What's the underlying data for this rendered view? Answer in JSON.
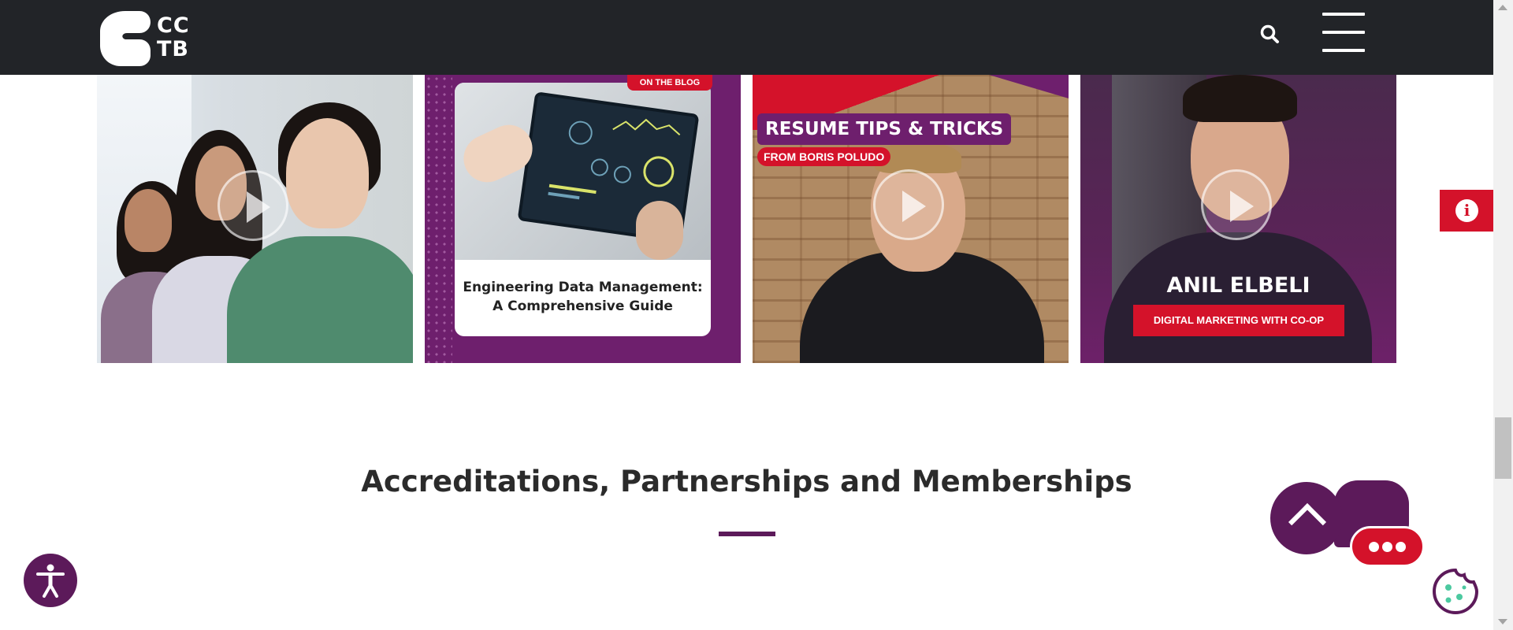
{
  "header": {
    "logo_text_line1": "CC",
    "logo_text_line2": "TB",
    "search_icon": "search-icon",
    "menu_icon": "hamburger-menu-icon"
  },
  "cards": [
    {
      "type": "video",
      "label": "students-video"
    },
    {
      "type": "blog",
      "badge": "ON THE BLOG",
      "title_line1": "Engineering Data Management:",
      "title_line2": "A Comprehensive Guide"
    },
    {
      "type": "video",
      "title": "RESUME TIPS & TRICKS",
      "subtitle": "FROM BORIS POLUDO"
    },
    {
      "type": "video",
      "name": "ANIL ELBELI",
      "tag": "DIGITAL MARKETING WITH CO-OP"
    }
  ],
  "section": {
    "title": "Accreditations, Partnerships and Memberships"
  },
  "floating": {
    "info_icon_glyph": "i",
    "accessibility_icon": "accessibility-icon",
    "back_to_top_icon": "chevron-up-icon",
    "chat_icon": "chat-icon",
    "cookie_icon": "cookie-icon"
  },
  "colors": {
    "header_bg": "#222428",
    "brand_purple": "#5c1a5a",
    "brand_red": "#d4122a"
  }
}
